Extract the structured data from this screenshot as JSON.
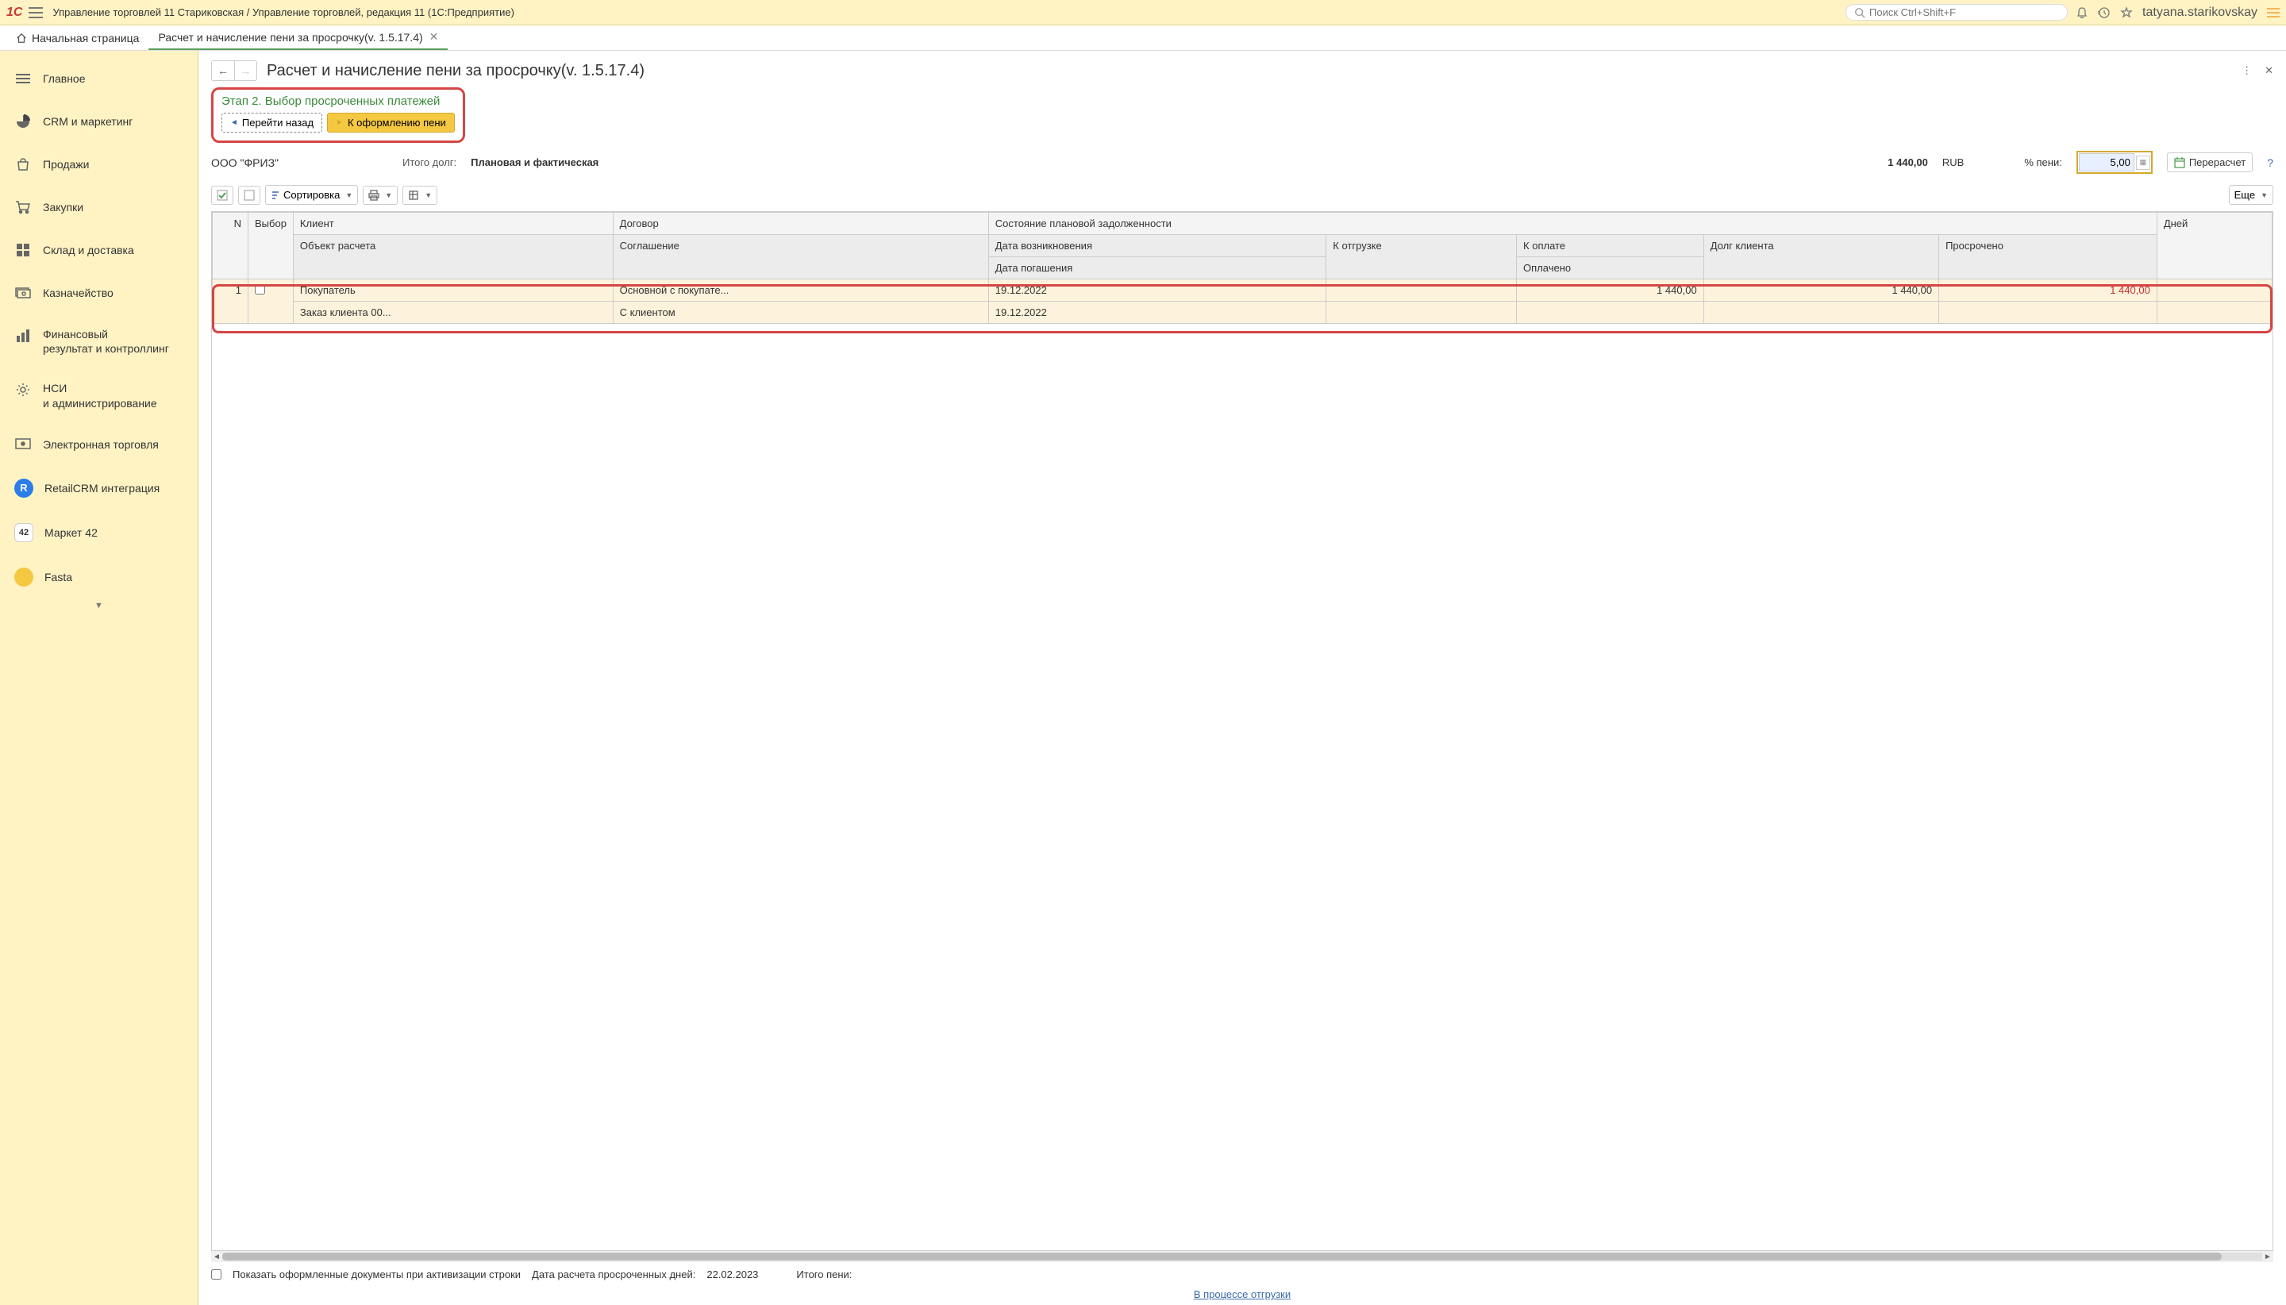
{
  "header": {
    "title": "Управление торговлей 11 Стариковская / Управление торговлей, редакция 11  (1С:Предприятие)",
    "search_placeholder": "Поиск Ctrl+Shift+F",
    "username": "tatyana.starikovskay"
  },
  "tabs": {
    "home": "Начальная страница",
    "active": "Расчет и начисление пени за просрочку(v. 1.5.17.4)"
  },
  "sidebar": {
    "items": [
      {
        "label": "Главное"
      },
      {
        "label": "CRM и маркетинг"
      },
      {
        "label": "Продажи"
      },
      {
        "label": "Закупки"
      },
      {
        "label": "Склад и доставка"
      },
      {
        "label": "Казначейство"
      },
      {
        "label": "Финансовый\nрезультат и контроллинг"
      },
      {
        "label": "НСИ\nи администрирование"
      },
      {
        "label": "Электронная торговля"
      },
      {
        "label": "RetailCRM интеграция"
      },
      {
        "label": "Маркет 42"
      },
      {
        "label": "Fasta"
      }
    ]
  },
  "page": {
    "title": "Расчет и начисление пени за просрочку(v. 1.5.17.4)",
    "stage_title": "Этап 2. Выбор просроченных платежей",
    "btn_back": "Перейти назад",
    "btn_forward": "К оформлению  пени",
    "org": "ООО \"ФРИЗ\"",
    "total_debt_label": "Итого долг:",
    "debt_type": "Плановая и фактическая",
    "total_amount": "1 440,00",
    "currency": "RUB",
    "pct_label": "% пени:",
    "pct_value": "5,00",
    "btn_recalc": "Перерасчет",
    "sort_btn": "Сортировка",
    "more_btn": "Еще"
  },
  "table": {
    "headers": {
      "n": "N",
      "select": "Выбор",
      "client": "Клиент",
      "contract": "Договор",
      "plan_state": "Состояние плановой задолженности",
      "calc_object": "Объект расчета",
      "agreement": "Соглашение",
      "date_occur": "Дата возникновения",
      "to_ship": "К отгрузке",
      "to_pay": "К оплате",
      "client_debt": "Долг клиента",
      "overdue": "Просрочено",
      "days": "Дней",
      "date_repay": "Дата погашения",
      "paid": "Оплачено"
    },
    "row": {
      "n": "1",
      "client": "Покупатель",
      "contract": "Основной с покупате...",
      "calc_object": "Заказ клиента 00...",
      "agreement": "С клиентом",
      "date_occur": "19.12.2022",
      "date_repay": "19.12.2022",
      "to_pay": "1 440,00",
      "client_debt": "1 440,00",
      "overdue": "1 440,00"
    }
  },
  "footer": {
    "show_docs": "Показать  оформленные документы  при активизации строки",
    "calc_date_label": "Дата расчета  просроченных дней:",
    "calc_date": "22.02.2023",
    "total_peni": "Итого пени:",
    "link": "В процессе отгрузки"
  }
}
